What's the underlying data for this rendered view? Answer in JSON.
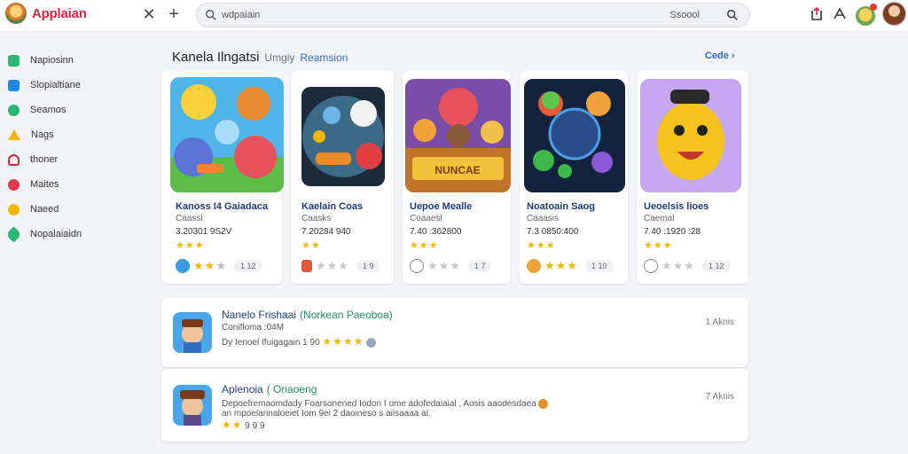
{
  "app": {
    "title": "Applaian"
  },
  "toolbar": {
    "close_label": "✕",
    "add_label": "+"
  },
  "search": {
    "placeholder": "wdpaiain",
    "button_label": "Ssoool"
  },
  "sidebar": {
    "items": [
      {
        "label": "Napiosinn",
        "icon": "grid-icon",
        "color": "#2bb673"
      },
      {
        "label": "Slopialtiane",
        "icon": "apps-icon",
        "color": "#1e88e5"
      },
      {
        "label": "Seamos",
        "icon": "games-icon",
        "color": "#2bb673"
      },
      {
        "label": "Nags",
        "icon": "warning-icon",
        "color": "#f2b705"
      },
      {
        "label": "thoner",
        "icon": "cat-icon",
        "color": "#d8233f"
      },
      {
        "label": "Maites",
        "icon": "tag-icon",
        "color": "#e53950"
      },
      {
        "label": "Naeed",
        "icon": "gift-icon",
        "color": "#f2b705"
      },
      {
        "label": "Nopalaiaidn",
        "icon": "bookmark-icon",
        "color": "#2bb673"
      }
    ]
  },
  "section": {
    "title": "Kanela Ilngatsi",
    "sub": "Umgiy",
    "sub2": "Reamsion",
    "see_more": "Cede"
  },
  "games": [
    {
      "title": "Kanoss I4 Gaiadaca",
      "sub": "Caassl",
      "meta": "3.20301 9S2V",
      "stars": "★★★",
      "badge": "1 12"
    },
    {
      "title": "Kaelain Coas",
      "sub": "Caasks",
      "meta": "7.20284 940",
      "stars": "★★",
      "badge": "1 9"
    },
    {
      "title": "Uepoe Mealle",
      "sub": "Coaaesl",
      "meta": "7.40 :362800",
      "stars": "★★★",
      "badge": "1 7"
    },
    {
      "title": "Noatoain Saog",
      "sub": "Caaasis",
      "meta": "7.3 0850:400",
      "stars": "★★★",
      "badge": "1 10"
    },
    {
      "title": "Ueoelsis lioes",
      "sub": "Caemal",
      "meta": "7.40 :1920 :28",
      "stars": "★★★",
      "badge": "1 12"
    }
  ],
  "list": [
    {
      "title": "Nanelo Frishaai",
      "tag": "(Norkean Paeoboa)",
      "line1": "Conifloma :04M",
      "line2": "Dy Ienoel Ifuigagain 1 90",
      "stars": "★★★★",
      "right": "1 Aknis"
    },
    {
      "title": "Aplenoia",
      "tag": "( Oriaoeng",
      "line1": "Depoefremaomdady Foarsonened Iodon I ome adofedaiaial , Aosis aaodesdaea",
      "line2": "an mpoelarinaloeiet Iom 9ei 2 daoineso s aiisaaaa al.",
      "stars": "★★",
      "stars_extra": "9 9 9",
      "right": "7 Aknis"
    }
  ]
}
